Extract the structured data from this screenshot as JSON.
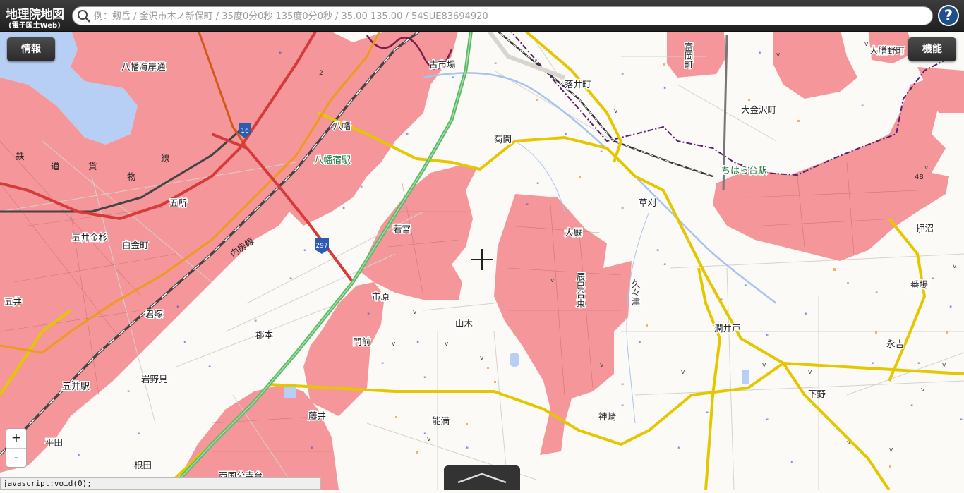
{
  "header": {
    "logo_title": "地理院地図",
    "logo_subtitle": "(電子国土Web)",
    "search_placeholder": "例：剱岳 / 金沢市木ノ新保町 / 35度0分0秒 135度0分0秒 / 35.00 135.00 / 54SUE83694920",
    "help_label": "?"
  },
  "buttons": {
    "info": "情報",
    "functions": "機能"
  },
  "zoom": {
    "in": "+",
    "out": "-"
  },
  "status_text": "javascript:void(0);",
  "map": {
    "place_names": [
      "八幡海岸通",
      "古市場",
      "落井町",
      "富岡町",
      "大膳野町",
      "大金沢町",
      "鉄",
      "道",
      "貨",
      "物",
      "線",
      "五所",
      "五井金杉",
      "白金町",
      "八幡",
      "八幡宿駅",
      "菊間",
      "ちはら台駅",
      "草刈",
      "押沼",
      "若宮",
      "大厩",
      "辰巳台東",
      "久々津",
      "番場",
      "市原",
      "山木",
      "内房線",
      "潤井戸",
      "永吉",
      "郡本",
      "門前",
      "五井",
      "君塚",
      "五井駅",
      "岩野見",
      "藤井",
      "能満",
      "神崎",
      "下野",
      "平田",
      "根田",
      "西国分寺台"
    ],
    "route_numbers": [
      "16",
      "297"
    ],
    "elevation": "48",
    "spot_mark": "2",
    "colors": {
      "urban": "#f4969a",
      "water": "#b8cff5",
      "expressway": "#5cb866",
      "national_road": "#e34c4c",
      "prefectural_road": "#f0d419",
      "rail": "#333333",
      "boundary": "#5a1e6e"
    }
  }
}
